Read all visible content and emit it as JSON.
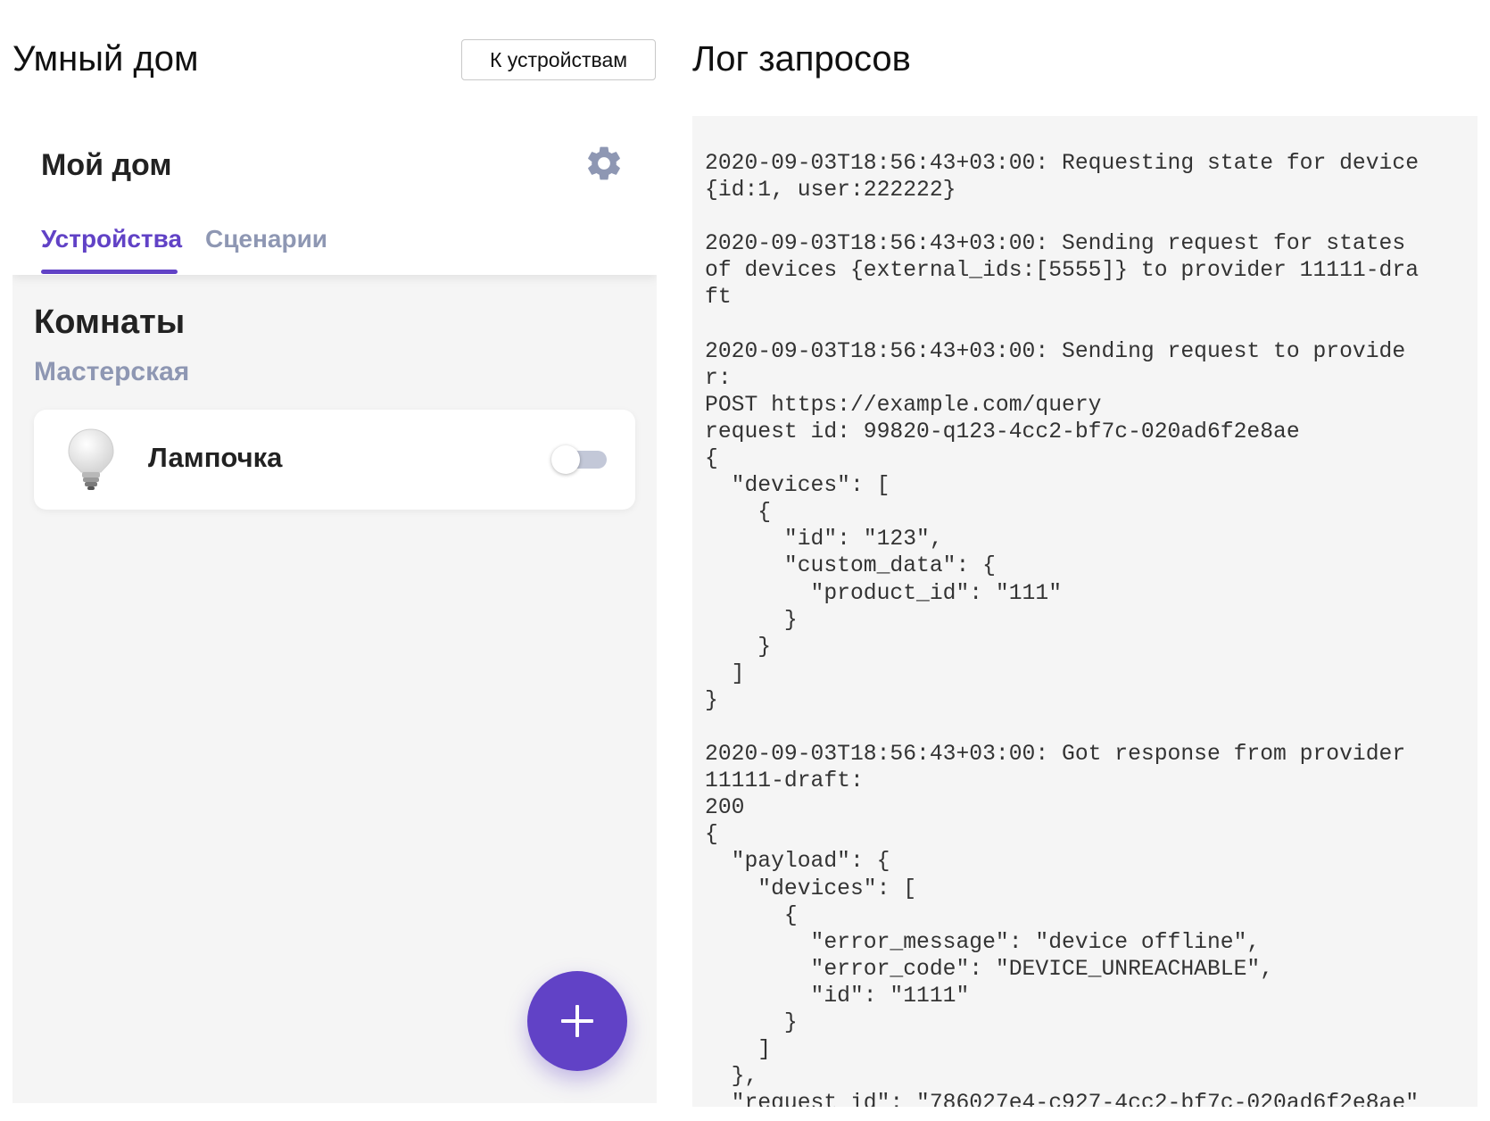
{
  "header": {
    "app_title": "Умный дом",
    "to_devices_button": "К устройствам",
    "log_title": "Лог запросов"
  },
  "home": {
    "title": "Мой дом",
    "settings_icon": "gear-icon",
    "tabs": [
      {
        "label": "Устройства",
        "active": true
      },
      {
        "label": "Сценарии",
        "active": false
      }
    ],
    "rooms_title": "Комнаты",
    "room_name": "Мастерская",
    "device": {
      "name": "Лампочка",
      "icon": "bulb-icon",
      "on": false
    },
    "add_button_icon": "plus-icon"
  },
  "colors": {
    "accent": "#6142c6",
    "muted": "#8e97b3",
    "panel_bg": "#f5f5f5"
  },
  "log": {
    "text": "2020-09-03T18:56:43+03:00: Requesting state for device\n{id:1, user:222222}\n\n2020-09-03T18:56:43+03:00: Sending request for states\nof devices {external_ids:[5555]} to provider 11111-dra\nft\n\n2020-09-03T18:56:43+03:00: Sending request to provide\nr:\nPOST https://example.com/query\nrequest id: 99820-q123-4cc2-bf7c-020ad6f2e8ae\n{\n  \"devices\": [\n    {\n      \"id\": \"123\",\n      \"custom_data\": {\n        \"product_id\": \"111\"\n      }\n    }\n  ]\n}\n\n2020-09-03T18:56:43+03:00: Got response from provider\n11111-draft:\n200\n{\n  \"payload\": {\n    \"devices\": [\n      {\n        \"error_message\": \"device offline\",\n        \"error_code\": \"DEVICE_UNREACHABLE\",\n        \"id\": \"1111\"\n      }\n    ]\n  },\n  \"request_id\": \"786027e4-c927-4cc2-bf7c-020ad6f2e8ae\""
  }
}
